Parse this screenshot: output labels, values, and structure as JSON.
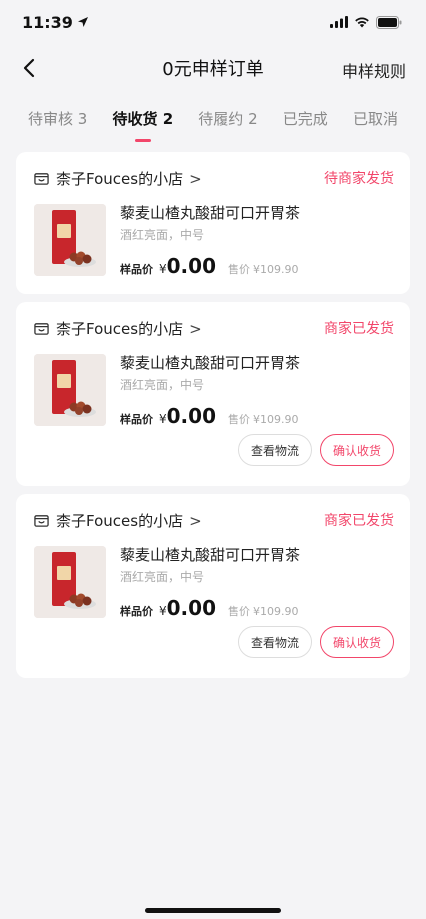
{
  "status_bar": {
    "time": "11:39",
    "location_icon": "location-arrow-icon",
    "icons": [
      "signal-icon",
      "wifi-icon",
      "battery-icon"
    ]
  },
  "nav": {
    "title": "0元申样订单",
    "rules_label": "申样规则",
    "back_icon": "chevron-left-icon"
  },
  "tabs": [
    {
      "label": "待审核 3",
      "active": false
    },
    {
      "label": "待收货 2",
      "active": true
    },
    {
      "label": "待履约 2",
      "active": false
    },
    {
      "label": "已完成",
      "active": false
    },
    {
      "label": "已取消",
      "active": false
    }
  ],
  "orders": [
    {
      "shop_name": "柰子Fouces的小店",
      "chevron": ">",
      "status": "待商家发货",
      "product_name": "藜麦山楂丸酸甜可口开胃茶",
      "spec": "酒红亮面，中号",
      "sample_price_label": "样品价",
      "sample_currency": "¥",
      "sample_price": "0.00",
      "sale_label": "售价",
      "sale_price": "¥109.90",
      "actions": []
    },
    {
      "shop_name": "柰子Fouces的小店",
      "chevron": ">",
      "status": "商家已发货",
      "product_name": "藜麦山楂丸酸甜可口开胃茶",
      "spec": "酒红亮面，中号",
      "sample_price_label": "样品价",
      "sample_currency": "¥",
      "sample_price": "0.00",
      "sale_label": "售价",
      "sale_price": "¥109.90",
      "actions": [
        "查看物流",
        "确认收货"
      ]
    },
    {
      "shop_name": "柰子Fouces的小店",
      "chevron": ">",
      "status": "商家已发货",
      "product_name": "藜麦山楂丸酸甜可口开胃茶",
      "spec": "酒红亮面，中号",
      "sample_price_label": "样品价",
      "sample_currency": "¥",
      "sample_price": "0.00",
      "sale_label": "售价",
      "sale_price": "¥109.90",
      "actions": [
        "查看物流",
        "确认收货"
      ]
    }
  ],
  "colors": {
    "accent": "#f2466a",
    "background": "#f4f4f6",
    "card": "#ffffff"
  }
}
